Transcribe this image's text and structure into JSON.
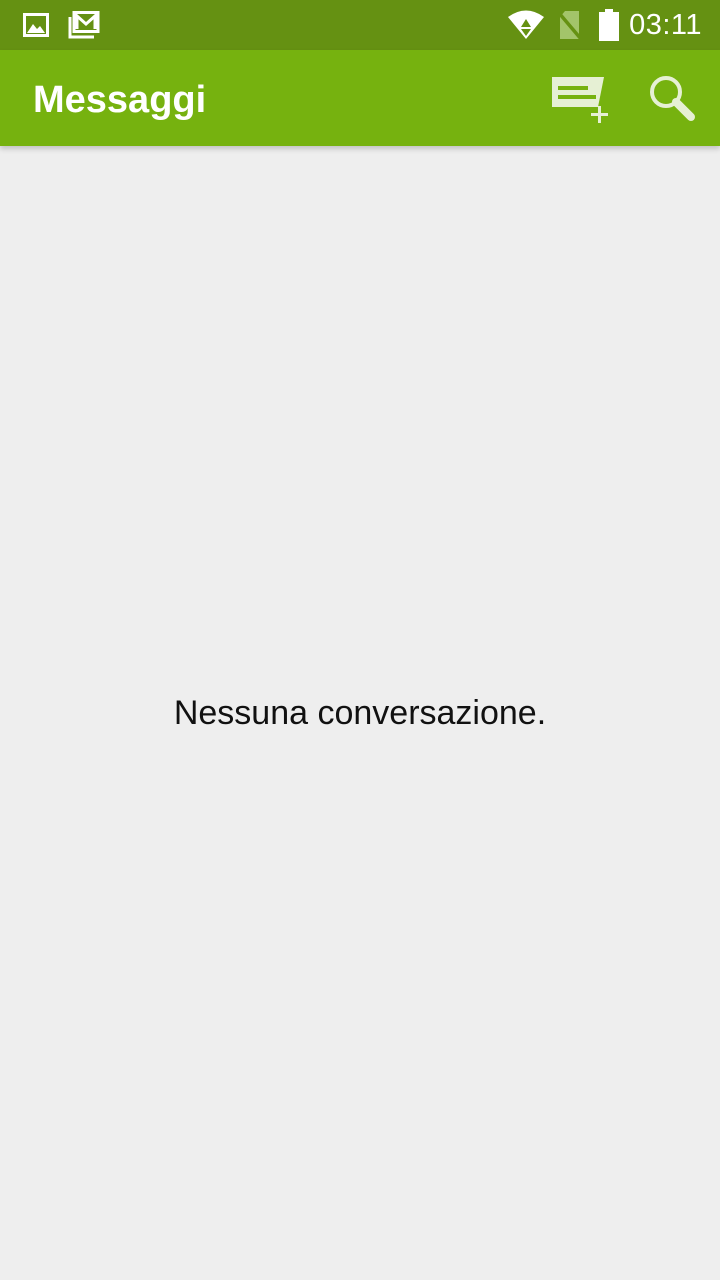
{
  "status_bar": {
    "time": "03:11",
    "icons": [
      "image-notification-icon",
      "gmail-notification-icon",
      "wifi-icon",
      "no-sim-icon",
      "battery-icon"
    ]
  },
  "app_bar": {
    "title": "Messaggi",
    "actions": [
      "new-message-icon",
      "search-icon"
    ]
  },
  "conversation_list": {
    "empty_text": "Nessuna conversazione."
  },
  "colors": {
    "status_bar": "#659112",
    "app_bar": "#76b20f",
    "background": "#eeeeee"
  }
}
